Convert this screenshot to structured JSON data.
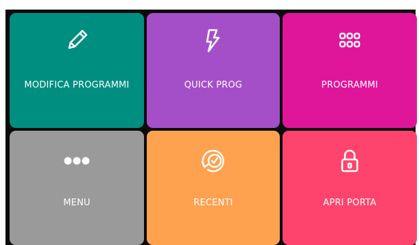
{
  "tiles": [
    {
      "label": "MODIFICA PROGRAMMI",
      "icon": "pencil-icon",
      "color": "#008e80"
    },
    {
      "label": "QUICK PROG",
      "icon": "lightning-bolt-icon",
      "color": "#a44fc8"
    },
    {
      "label": "PROGRAMMI",
      "icon": "grid-dots-icon",
      "color": "#e0169a"
    },
    {
      "label": "MENU",
      "icon": "more-dots-icon",
      "color": "#9a9a9a"
    },
    {
      "label": "RECENTI",
      "icon": "history-clock-icon",
      "color": "#fea250"
    },
    {
      "label": "APRI PORTA",
      "icon": "lock-icon",
      "color": "#fe446c"
    }
  ]
}
